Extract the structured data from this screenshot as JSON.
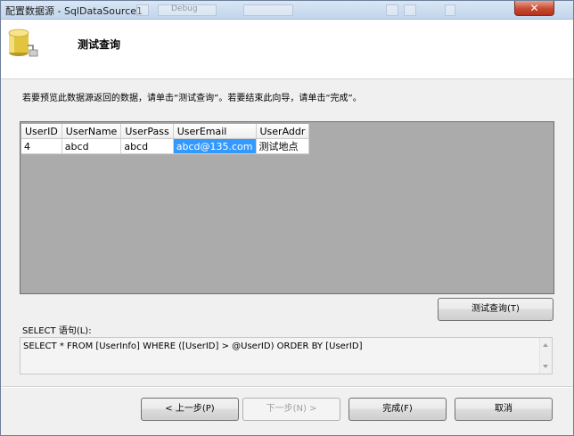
{
  "window": {
    "title": "配置数据源 - SqlDataSource1",
    "background_ghost_text": "Debug",
    "close_glyph": "✕"
  },
  "header": {
    "icon": "database-icon",
    "step_title": "测试查询"
  },
  "instruction": "若要预览此数据源返回的数据，请单击“测试查询”。若要结束此向导，请单击“完成”。",
  "grid": {
    "columns": [
      "UserID",
      "UserName",
      "UserPass",
      "UserEmail",
      "UserAddr"
    ],
    "rows": [
      [
        "4",
        "abcd",
        "abcd",
        "abcd@135.com",
        "测试地点"
      ]
    ]
  },
  "test_query_button": "测试查询(T)",
  "sql": {
    "label": "SELECT 语句(L):",
    "text": "SELECT * FROM [UserInfo] WHERE ([UserID] > @UserID) ORDER BY [UserID]"
  },
  "footer": {
    "prev": "< 上一步(P)",
    "next": "下一步(N) >",
    "finish": "完成(F)",
    "cancel": "取消"
  },
  "colors": {
    "selection": "#3399ff",
    "grid_background": "#ababab",
    "close_button": "#c74a32"
  }
}
